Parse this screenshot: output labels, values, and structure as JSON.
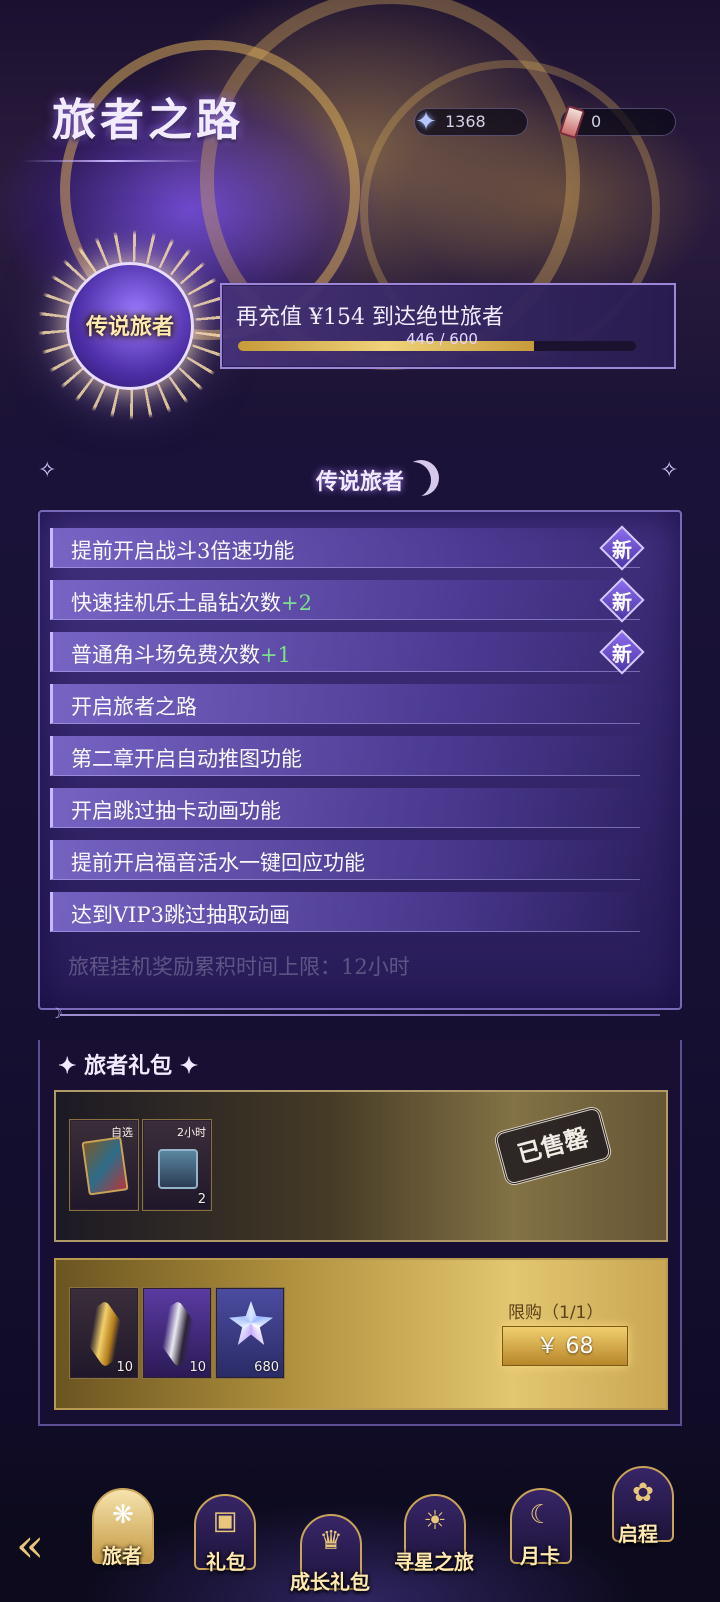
{
  "header": {
    "title": "旅者之路"
  },
  "currencies": [
    {
      "icon": "star-crystal-icon",
      "value": "1368"
    },
    {
      "icon": "ticket-icon",
      "value": "0"
    }
  ],
  "tier_badge": {
    "label": "传说旅者"
  },
  "progress": {
    "message": "再充值 ¥154 到达绝世旅者",
    "current": 446,
    "max": 600,
    "label": "446 / 600"
  },
  "tier_section": {
    "title": "传说旅者"
  },
  "perks": [
    {
      "text": "提前开启战斗3倍速功能",
      "bonus": "",
      "badge": "新"
    },
    {
      "text": "快速挂机乐土晶钻次数",
      "bonus": "+2",
      "badge": "新"
    },
    {
      "text": "普通角斗场免费次数",
      "bonus": "+1",
      "badge": "新"
    },
    {
      "text": "开启旅者之路",
      "bonus": "",
      "badge": ""
    },
    {
      "text": "第二章开启自动推图功能",
      "bonus": "",
      "badge": ""
    },
    {
      "text": "开启跳过抽卡动画功能",
      "bonus": "",
      "badge": ""
    },
    {
      "text": "提前开启福音活水一键回应功能",
      "bonus": "",
      "badge": ""
    },
    {
      "text": "达到VIP3跳过抽取动画",
      "bonus": "",
      "badge": ""
    },
    {
      "text": "旅程挂机奖励累积时间上限：12小时",
      "bonus": "",
      "badge": ""
    }
  ],
  "gift_section": {
    "title": "✦ 旅者礼包 ✦"
  },
  "packs": [
    {
      "status": "已售罄",
      "items": [
        {
          "icon": "selectable-card-icon",
          "tag": "自选",
          "qty": ""
        },
        {
          "icon": "treasure-chest-icon",
          "tag": "2小时",
          "qty": "2"
        }
      ]
    },
    {
      "limit": "限购（1/1）",
      "price": "￥ 68",
      "items": [
        {
          "icon": "gold-feather-icon",
          "tag": "",
          "qty": "10"
        },
        {
          "icon": "dark-feather-icon",
          "tag": "",
          "qty": "10"
        },
        {
          "icon": "star-crystal-icon",
          "tag": "",
          "qty": "680"
        }
      ]
    }
  ],
  "nav": {
    "tabs": [
      {
        "label": "旅者",
        "icon": "traveler-emblem-icon",
        "active": true
      },
      {
        "label": "礼包",
        "icon": "gift-box-icon",
        "active": false
      },
      {
        "label": "成长礼包",
        "icon": "growth-pack-icon",
        "active": false
      },
      {
        "label": "寻星之旅",
        "icon": "star-journey-icon",
        "active": false
      },
      {
        "label": "月卡",
        "icon": "moon-card-icon",
        "active": false
      },
      {
        "label": "启程",
        "icon": "rose-emblem-icon",
        "active": false
      }
    ]
  }
}
